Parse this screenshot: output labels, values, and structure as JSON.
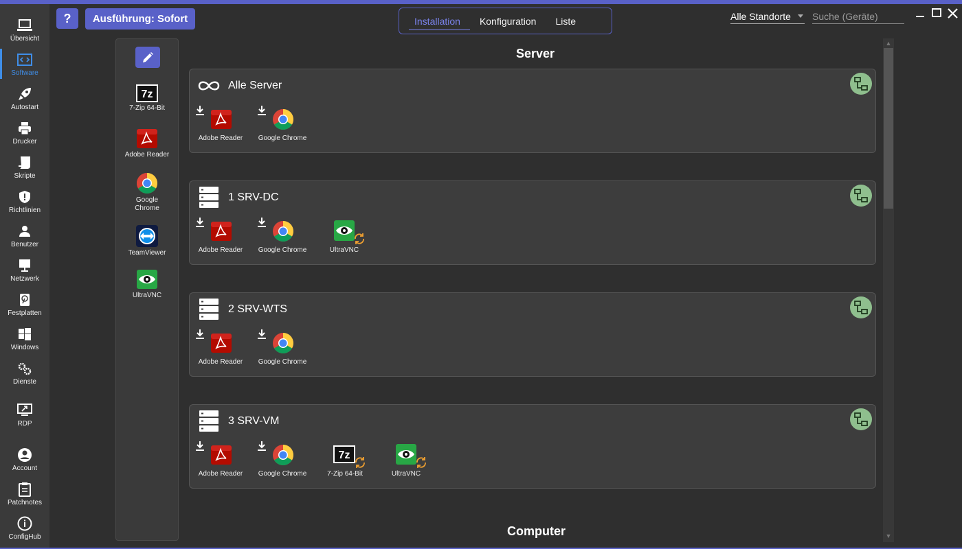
{
  "nav": [
    {
      "label": "Übersicht",
      "icon": "laptop-icon"
    },
    {
      "label": "Software",
      "icon": "code-icon",
      "active": true
    },
    {
      "label": "Autostart",
      "icon": "rocket-icon"
    },
    {
      "label": "Drucker",
      "icon": "printer-icon"
    },
    {
      "label": "Skripte",
      "icon": "script-icon"
    },
    {
      "label": "Richtlinien",
      "icon": "shield-icon"
    },
    {
      "label": "Benutzer",
      "icon": "user-icon"
    },
    {
      "label": "Netzwerk",
      "icon": "monitor-icon"
    },
    {
      "label": "Festplatten",
      "icon": "harddisk-icon"
    },
    {
      "label": "Windows",
      "icon": "windows-icon"
    },
    {
      "label": "Dienste",
      "icon": "cogs-icon"
    },
    {
      "label": "RDP",
      "icon": "remote-desktop-icon"
    },
    {
      "label": "Account",
      "icon": "account-icon"
    },
    {
      "label": "Patchnotes",
      "icon": "clipboard-icon"
    },
    {
      "label": "ConfigHub",
      "icon": "info-icon"
    }
  ],
  "toolbar": {
    "help_label": "?",
    "exec_label": "Ausführung: Sofort",
    "tabs": [
      "Installation",
      "Konfiguration",
      "Liste"
    ],
    "active_tab": "Installation",
    "location": "Alle Standorte",
    "search_placeholder": "Suche (Geräte)"
  },
  "palette": [
    {
      "label": "7-Zip 64-Bit",
      "icon": "7zip-icon"
    },
    {
      "label": "Adobe Reader",
      "icon": "adobe-reader-icon"
    },
    {
      "label": "Google Chrome",
      "icon": "chrome-icon"
    },
    {
      "label": "TeamViewer",
      "icon": "teamviewer-icon"
    },
    {
      "label": "UltraVNC",
      "icon": "ultravnc-icon"
    }
  ],
  "sections": {
    "server": "Server",
    "computer": "Computer"
  },
  "groups": [
    {
      "title": "Alle Server",
      "icon": "infinity-icon",
      "software": [
        "Adobe Reader",
        "Google Chrome"
      ]
    },
    {
      "title": "1 SRV-DC",
      "icon": "server-icon",
      "software": [
        "Adobe Reader",
        "Google Chrome",
        "UltraVNC"
      ]
    },
    {
      "title": "2 SRV-WTS",
      "icon": "server-icon",
      "software": [
        "Adobe Reader",
        "Google Chrome"
      ]
    },
    {
      "title": "3 SRV-VM",
      "icon": "server-icon",
      "software": [
        "Adobe Reader",
        "Google Chrome",
        "7-Zip 64-Bit",
        "UltraVNC"
      ]
    }
  ],
  "colors": {
    "accent": "#5961c8",
    "active_nav": "#3f8ee8",
    "background": "#2f2f2f",
    "card": "#3d3d3d",
    "network_button": "#8fbf8e",
    "sync": "#f0a030"
  }
}
